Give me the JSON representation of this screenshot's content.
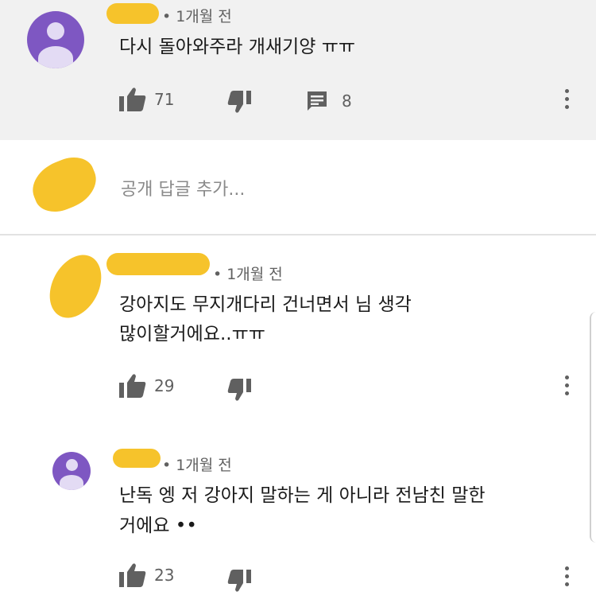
{
  "colors": {
    "accent_purple": "#7e57c2",
    "redaction_yellow": "#f6c32b",
    "meta_gray": "#606060",
    "top_background": "#f1f1f1"
  },
  "icons": {
    "like": "thumb-up-icon",
    "dislike": "thumb-down-icon",
    "reply": "comment-icon",
    "menu": "more-vert-icon"
  },
  "top_comment": {
    "timestamp": "1개월 전",
    "text": "다시 돌아와주라 개새기양 ㅠㅠ",
    "likes": "71",
    "replies": "8"
  },
  "reply_box": {
    "placeholder": "공개 답글 추가..."
  },
  "reply_1": {
    "timestamp": "1개월 전",
    "text_line_1": "강아지도 무지개다리 건너면서 님 생각",
    "text_line_2": "많이할거에요..ㅠㅠ",
    "likes": "29"
  },
  "reply_2": {
    "timestamp": "1개월 전",
    "text_line_1": "난독 엥 저 강아지 말하는 게 아니라 전남친 말한",
    "text_line_2": "거에요 ••",
    "likes": "23"
  }
}
